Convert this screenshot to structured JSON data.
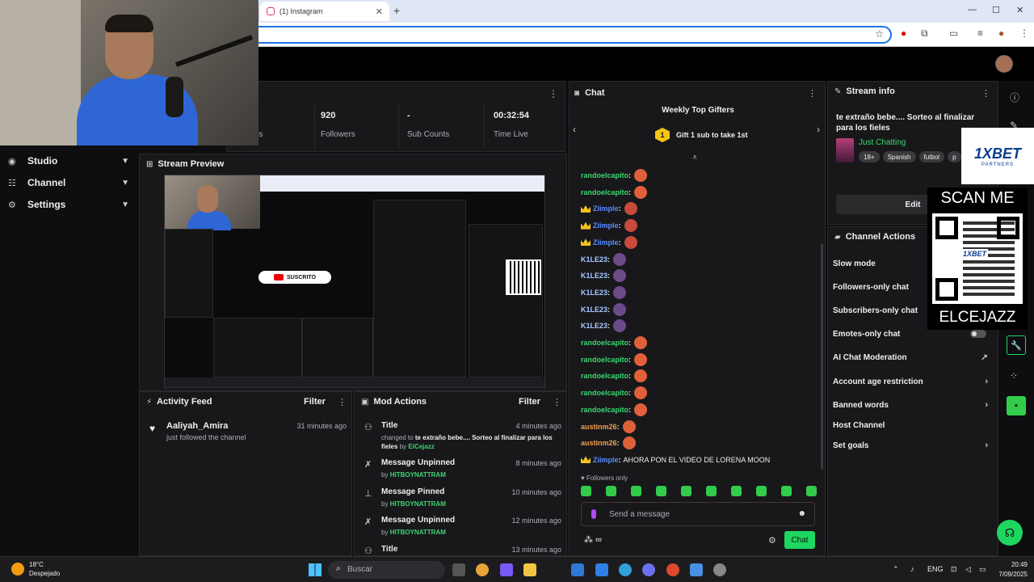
{
  "browser": {
    "tab_title": "(1) Instagram",
    "tab_close": "✕",
    "new_tab": "+",
    "controls": [
      "—",
      "☐",
      "✕"
    ]
  },
  "nav": {
    "items": [
      {
        "label": "Studio",
        "icon": "studio-icon"
      },
      {
        "label": "Channel",
        "icon": "channel-icon"
      },
      {
        "label": "Settings",
        "icon": "gear-icon"
      }
    ]
  },
  "stats": {
    "items": [
      {
        "value": "920",
        "label": "Followers"
      },
      {
        "value": "-",
        "label": "Sub Counts"
      },
      {
        "value": "00:32:54",
        "label": "Time Live"
      }
    ],
    "partial_label": "rs"
  },
  "preview": {
    "title": "Stream Preview",
    "subscribe_label": "SUSCRITO"
  },
  "activity": {
    "title": "Activity Feed",
    "filter": "Filter",
    "items": [
      {
        "name": "Aaliyah_Amira",
        "desc": "just followed the channel",
        "time": "31 minutes ago"
      }
    ]
  },
  "mod": {
    "title": "Mod Actions",
    "filter": "Filter",
    "items": [
      {
        "title": "Title",
        "time": "4 minutes ago",
        "pre": "changed to",
        "detail": "te extraño bebe.... Sorteo al finalizar para los fieles",
        "by": "by",
        "user": "ElCejazz",
        "icon": "user-edit-icon"
      },
      {
        "title": "Message Unpinned",
        "time": "8 minutes ago",
        "by": "by",
        "user": "HITBOYNATTRAM",
        "icon": "unpin-icon"
      },
      {
        "title": "Message Pinned",
        "time": "10 minutes ago",
        "by": "by",
        "user": "HITBOYNATTRAM",
        "icon": "pin-icon"
      },
      {
        "title": "Message Unpinned",
        "time": "12 minutes ago",
        "by": "by",
        "user": "HITBOYNATTRAM",
        "icon": "unpin-icon"
      },
      {
        "title": "Title",
        "time": "13 minutes ago",
        "icon": "user-edit-icon"
      }
    ]
  },
  "chat": {
    "title": "Chat",
    "gifters_title": "Weekly Top Gifters",
    "gift_badge": "1",
    "gift_text": "Gift 1 sub to take 1st",
    "lines": [
      {
        "user": "randoelcapito",
        "color": "#3bd671",
        "crown": false,
        "emote": "#e0603a"
      },
      {
        "user": "randoelcapito",
        "color": "#3bd671",
        "crown": false,
        "emote": "#e0603a"
      },
      {
        "user": "Ziimple",
        "color": "#5b8cff",
        "crown": true,
        "emote": "#c94a3a"
      },
      {
        "user": "Ziimple",
        "color": "#5b8cff",
        "crown": true,
        "emote": "#c94a3a"
      },
      {
        "user": "Ziimple",
        "color": "#5b8cff",
        "crown": true,
        "emote": "#c94a3a"
      },
      {
        "user": "K1LE23",
        "color": "#a9c7ff",
        "crown": false,
        "emote": "#6b4a8a"
      },
      {
        "user": "K1LE23",
        "color": "#a9c7ff",
        "crown": false,
        "emote": "#6b4a8a"
      },
      {
        "user": "K1LE23",
        "color": "#a9c7ff",
        "crown": false,
        "emote": "#6b4a8a"
      },
      {
        "user": "K1LE23",
        "color": "#a9c7ff",
        "crown": false,
        "emote": "#6b4a8a"
      },
      {
        "user": "K1LE23",
        "color": "#a9c7ff",
        "crown": false,
        "emote": "#6b4a8a"
      },
      {
        "user": "randoelcapito",
        "color": "#3bd671",
        "crown": false,
        "emote": "#e0603a"
      },
      {
        "user": "randoelcapito",
        "color": "#3bd671",
        "crown": false,
        "emote": "#e0603a"
      },
      {
        "user": "randoelcapito",
        "color": "#3bd671",
        "crown": false,
        "emote": "#e0603a"
      },
      {
        "user": "randoelcapito",
        "color": "#3bd671",
        "crown": false,
        "emote": "#e0603a"
      },
      {
        "user": "randoelcapito",
        "color": "#3bd671",
        "crown": false,
        "emote": "#e0603a"
      },
      {
        "user": "austinm26",
        "color": "#f0a14a",
        "crown": false,
        "emote": "#e0603a"
      },
      {
        "user": "austinm26",
        "color": "#f0a14a",
        "crown": false,
        "emote": "#e0603a"
      },
      {
        "user": "Ziimple",
        "color": "#5b8cff",
        "crown": true,
        "message": "AHORA PON EL VIDEO DE LORENA MOON"
      }
    ],
    "followers_only": "♥ Followers only",
    "input_placeholder": "Send a message",
    "footer_label": "∞",
    "send_label": "Chat"
  },
  "stream_info": {
    "title": "Stream info",
    "stream_title": "te extraño bebe.... Sorteo al finalizar para los fieles",
    "category": "Just Chatting",
    "tags": [
      "18+",
      "Spanish",
      "futbol",
      "p"
    ],
    "edit_label": "Edit"
  },
  "channel_actions": {
    "title": "Channel Actions",
    "items": [
      {
        "label": "Slow mode",
        "type": "toggle"
      },
      {
        "label": "Followers-only chat",
        "type": "toggle"
      },
      {
        "label": "Subscribers-only chat",
        "type": "toggle"
      },
      {
        "label": "Emotes-only chat",
        "type": "toggle"
      },
      {
        "label": "AI Chat Moderation",
        "type": "external"
      },
      {
        "label": "Account age restriction",
        "type": "arrow"
      },
      {
        "label": "Banned words",
        "type": "arrow"
      },
      {
        "label": "Host Channel",
        "type": "none"
      },
      {
        "label": "Set goals",
        "type": "arrow"
      }
    ]
  },
  "ad": {
    "brand": "1XBET",
    "brand_sub": "PARTNERS",
    "scan": "SCAN ME",
    "qr_brand": "1XBET",
    "name": "ELCEJAZZ"
  },
  "taskbar": {
    "temp": "18°C",
    "weather": "Despejado",
    "weather_badge": "2",
    "search_placeholder": "Buscar",
    "lang": "ENG",
    "time": "20:49",
    "date": "7/09/2025"
  },
  "colors": {
    "accent": "#1ed760",
    "panel": "#18181b",
    "bg": "#0e0e10"
  }
}
